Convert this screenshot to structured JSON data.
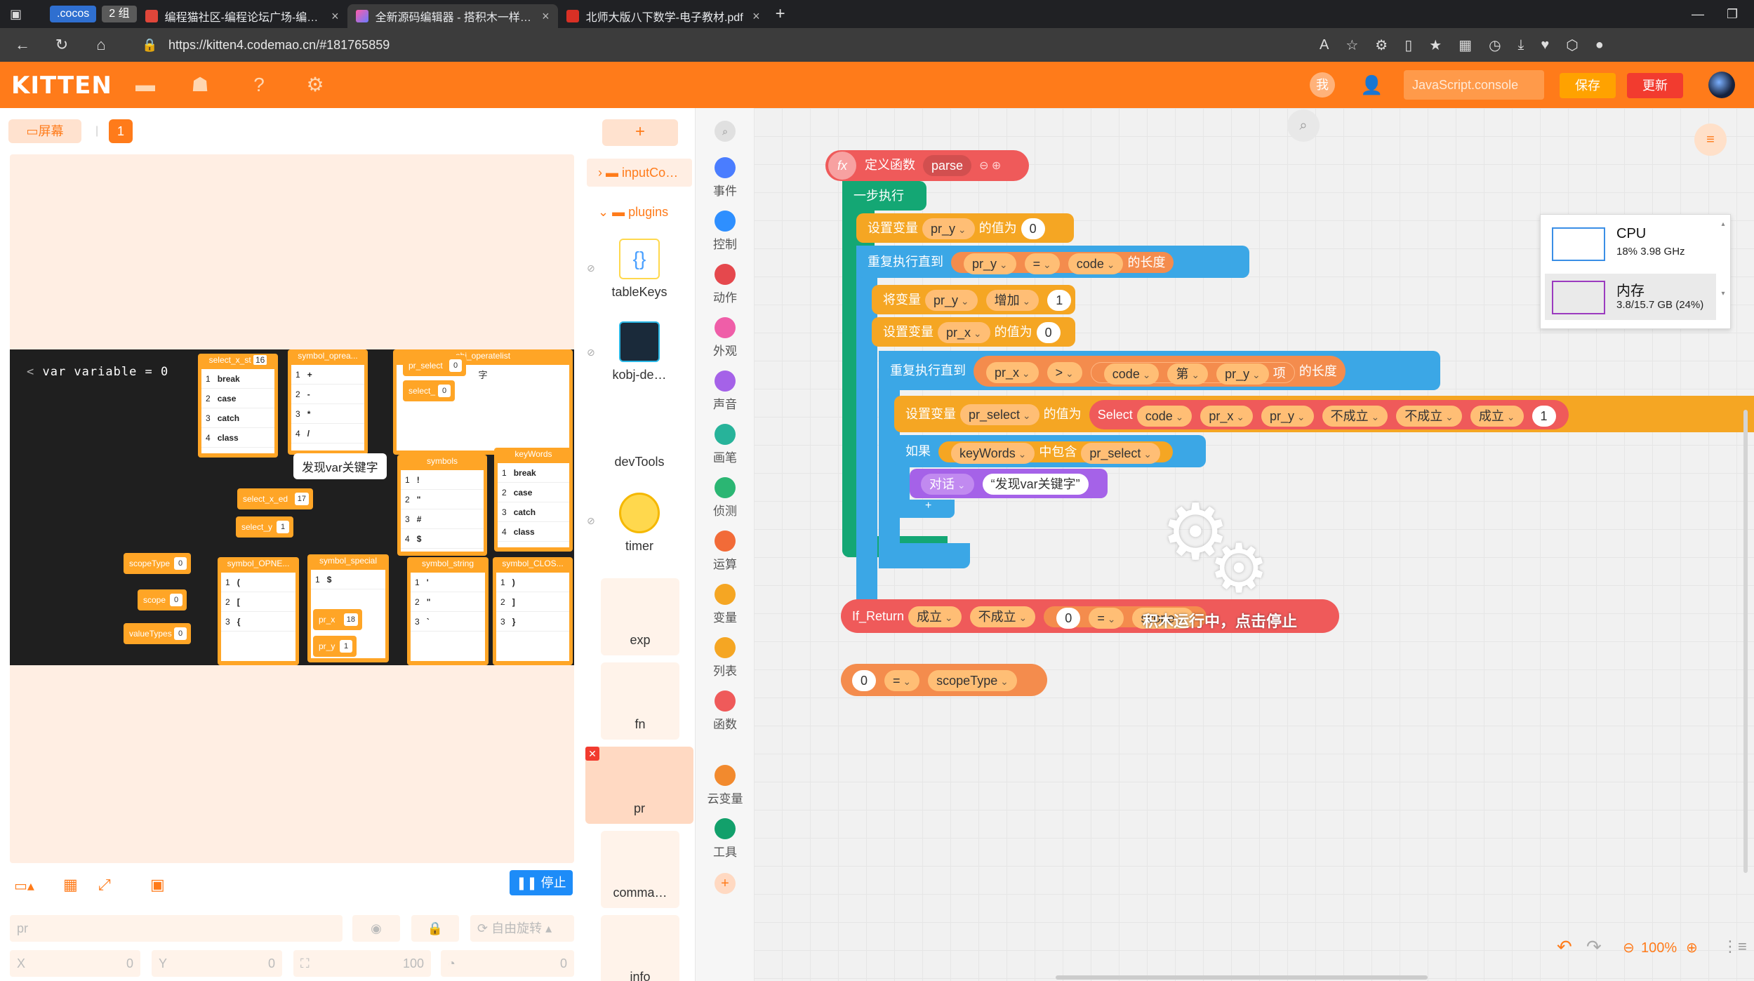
{
  "browser": {
    "tab_badges": [
      ".cocos",
      "2 组"
    ],
    "tabs": [
      {
        "title": "编程猫社区-编程论坛广场-编程学",
        "active": false
      },
      {
        "title": "全新源码编辑器 - 搭积木一样有趣",
        "active": true
      },
      {
        "title": "北师大版八下数学-电子教材.pdf",
        "active": false
      }
    ],
    "url": "https://kitten4.codemao.cn/#181765859"
  },
  "header": {
    "logo": "KITTEN",
    "me_label": "我",
    "console_label": "JavaScript.console",
    "save_label": "保存",
    "update_label": "更新",
    "brand_color": "#ff7b1a"
  },
  "stage": {
    "fullscreen_label": "屏幕",
    "scene_number": "1",
    "var_text": "var variable = 0",
    "tooltip": "发现var关键字",
    "stop_label": "停止",
    "name_placeholder": "pr",
    "free_rotate_label": "自由旋转",
    "x_label": "X",
    "x_value": "0",
    "y_label": "Y",
    "y_value": "0",
    "size_value": "100",
    "rotation_value": "0",
    "monitors": [
      {
        "title": "select_x_st",
        "count": "16",
        "rows": [
          [
            "1",
            "break"
          ],
          [
            "2",
            "case"
          ],
          [
            "3",
            "catch"
          ],
          [
            "4",
            "class"
          ]
        ]
      },
      {
        "title": "symbol_oprea...",
        "rows": [
          [
            "1",
            "+"
          ],
          [
            "2",
            "-"
          ],
          [
            "3",
            "*"
          ],
          [
            "4",
            "/"
          ]
        ]
      },
      {
        "title": "pr_select",
        "count": "0"
      },
      {
        "title": "obj_operatelist",
        "rows": [
          [
            "",
            "字"
          ]
        ]
      },
      {
        "title": "select_",
        "count": "0"
      },
      {
        "title": "symbols",
        "rows": [
          [
            "1",
            "!"
          ],
          [
            "2",
            "\""
          ],
          [
            "3",
            "#"
          ],
          [
            "4",
            "$"
          ]
        ]
      },
      {
        "title": "keyWords",
        "rows": [
          [
            "1",
            "break"
          ],
          [
            "2",
            "case"
          ],
          [
            "3",
            "catch"
          ],
          [
            "4",
            "class"
          ]
        ]
      },
      {
        "title": "select_x_ed",
        "count": "17"
      },
      {
        "title": "select_y",
        "count": "1"
      },
      {
        "title": "scopeType",
        "count": "0"
      },
      {
        "title": "scope",
        "count": "0"
      },
      {
        "title": "valueTypes",
        "count": "0"
      },
      {
        "title": "symbol_OPNE...",
        "rows": [
          [
            "1",
            "("
          ],
          [
            "2",
            "["
          ],
          [
            "3",
            "{"
          ]
        ]
      },
      {
        "title": "symbol_special",
        "rows": [
          [
            "1",
            "$"
          ]
        ]
      },
      {
        "title": "pr_x",
        "count": "18"
      },
      {
        "title": "pr_y",
        "count": "1"
      },
      {
        "title": "symbol_string",
        "rows": [
          [
            "1",
            "'"
          ],
          [
            "2",
            "\""
          ],
          [
            "3",
            "`"
          ]
        ]
      },
      {
        "title": "symbol_CLOS...",
        "rows": [
          [
            "1",
            ")"
          ],
          [
            "2",
            "]"
          ],
          [
            "3",
            "}"
          ]
        ]
      }
    ]
  },
  "sprites": {
    "add_label": "+",
    "folders": [
      {
        "label": "inputCo…",
        "expanded": false
      },
      {
        "label": "plugins",
        "expanded": true
      }
    ],
    "items": [
      "tableKeys",
      "kobj-de…",
      "devTools",
      "timer",
      "exp",
      "fn",
      "pr",
      "comma…",
      "info"
    ]
  },
  "categories": [
    {
      "label": "事件",
      "color": "#4a7dff"
    },
    {
      "label": "控制",
      "color": "#2e8fff"
    },
    {
      "label": "动作",
      "color": "#e5484d"
    },
    {
      "label": "外观",
      "color": "#ef5ea8"
    },
    {
      "label": "声音",
      "color": "#a562e8"
    },
    {
      "label": "画笔",
      "color": "#27b39a"
    },
    {
      "label": "侦测",
      "color": "#2bb673"
    },
    {
      "label": "运算",
      "color": "#f26b38"
    },
    {
      "label": "变量",
      "color": "#f5a623"
    },
    {
      "label": "列表",
      "color": "#f5a623"
    },
    {
      "label": "函数",
      "color": "#ef5a5a"
    },
    {
      "label": "云变量",
      "color": "#f28a2e"
    },
    {
      "label": "工具",
      "color": "#12a06b"
    }
  ],
  "workspace": {
    "define_func": "定义函数",
    "func_name": "parse",
    "step_run": "一步执行",
    "set_var": "设置变量",
    "value_of": "的值为",
    "repeat_until": "重复执行直到",
    "length_of": "的长度",
    "change_var": "将变量",
    "increase": "增加",
    "item_nth": "第",
    "item": "项",
    "if_label": "如果",
    "contains": "中包含",
    "say": "对话",
    "say_text": "发现var关键字",
    "select": "Select",
    "true_label": "成立",
    "false_label": "不成立",
    "if_return": "If_Return",
    "vars": {
      "pr_y": "pr_y",
      "pr_x": "pr_x",
      "pr_select": "pr_select",
      "code": "code",
      "keyWords": "keyWords",
      "scopeType": "scopeType",
      "scope": "scope"
    },
    "nums": {
      "zero": "0",
      "one": "1"
    },
    "ops": {
      "eq": "=",
      "gt": ">"
    },
    "running_text": "积木运行中，点击停止",
    "zoom": "100%"
  },
  "perf": {
    "cpu_label": "CPU",
    "cpu_value": "18%  3.98 GHz",
    "mem_label": "内存",
    "mem_value": "3.8/15.7 GB (24%)"
  }
}
